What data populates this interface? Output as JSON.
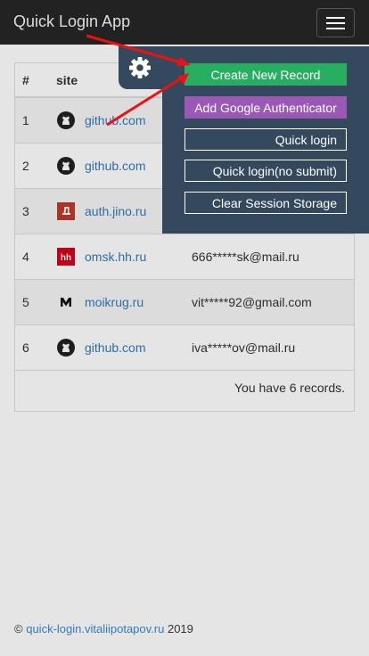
{
  "app": {
    "title": "Quick Login App"
  },
  "table": {
    "headers": [
      "#",
      "site"
    ],
    "rows": [
      {
        "num": "1",
        "icon": "github-icon",
        "site": "github.com",
        "login": ""
      },
      {
        "num": "2",
        "icon": "github-icon",
        "site": "github.com",
        "login": ""
      },
      {
        "num": "3",
        "icon": "jino-icon",
        "site": "auth.jino.ru",
        "login": ""
      },
      {
        "num": "4",
        "icon": "hh-icon",
        "site": "omsk.hh.ru",
        "login": "666*****sk@mail.ru"
      },
      {
        "num": "5",
        "icon": "moikrug-icon",
        "site": "moikrug.ru",
        "login": "vit*****92@gmail.com"
      },
      {
        "num": "6",
        "icon": "github-icon",
        "site": "github.com",
        "login": "iva*****ov@mail.ru"
      }
    ],
    "summary": "You have 6 records."
  },
  "menu": {
    "create": "Create New Record",
    "google_auth": "Add Google Authenticator",
    "quick_login": "Quick login",
    "quick_login_no_submit": "Quick login(no submit)",
    "clear_session": "Clear Session Storage"
  },
  "footer": {
    "copyright": "©",
    "link": "quick-login.vitaliipotapov.ru",
    "year": "2019"
  },
  "colors": {
    "navbar": "#222222",
    "menu_bg": "#34495e",
    "create_btn": "#27ae60",
    "google_btn": "#9b59b6",
    "link": "#337ab7",
    "arrow": "#ee1111"
  }
}
